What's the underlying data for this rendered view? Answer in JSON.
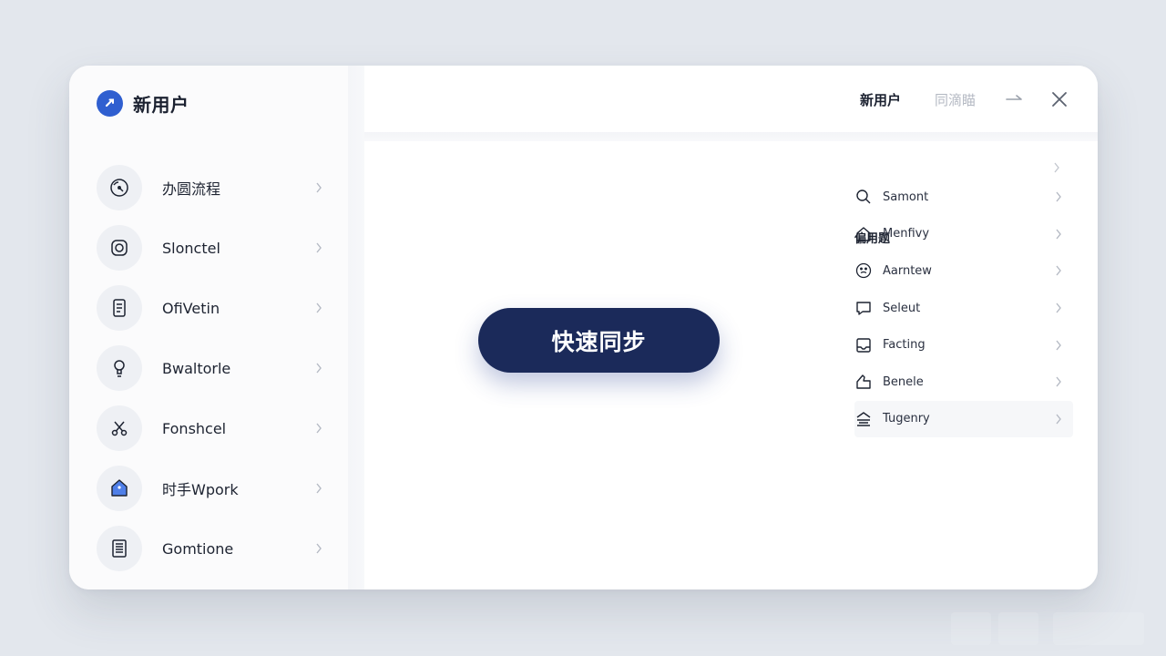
{
  "app": {
    "title": "新用户"
  },
  "sidebar": {
    "items": [
      {
        "label": "办圆流程",
        "icon": "gauge-icon"
      },
      {
        "label": "Slonctel",
        "icon": "camera-icon"
      },
      {
        "label": "OfiVetin",
        "icon": "document-icon"
      },
      {
        "label": "Bwaltorle",
        "icon": "lightbulb-icon"
      },
      {
        "label": "Fonshcel",
        "icon": "scissors-icon"
      },
      {
        "label": "时手Wpork",
        "icon": "tag-icon"
      },
      {
        "label": "Gomtione",
        "icon": "list-document-icon"
      }
    ]
  },
  "header": {
    "tabs": [
      {
        "label": "新用户",
        "active": true
      },
      {
        "label": "同滴瞄",
        "active": false
      }
    ],
    "icons": [
      "arrow-right-icon",
      "close-icon"
    ]
  },
  "main": {
    "sync_button_label": "快速同步"
  },
  "right_panel": {
    "title": "偏用题",
    "items": [
      {
        "label": "Samont",
        "icon": "search-icon"
      },
      {
        "label": "Menfivy",
        "icon": "home-icon"
      },
      {
        "label": "Aarntew",
        "icon": "emoji-icon"
      },
      {
        "label": "Seleut",
        "icon": "chat-icon"
      },
      {
        "label": "Facting",
        "icon": "inbox-icon"
      },
      {
        "label": "Benele",
        "icon": "thumbs-up-icon"
      },
      {
        "label": "Tugenry",
        "icon": "layers-icon",
        "highlighted": true
      }
    ]
  },
  "colors": {
    "accent": "#2f5fd0",
    "button_bg": "#1b2a5a",
    "background": "#e3e7ed",
    "card": "#ffffff"
  }
}
